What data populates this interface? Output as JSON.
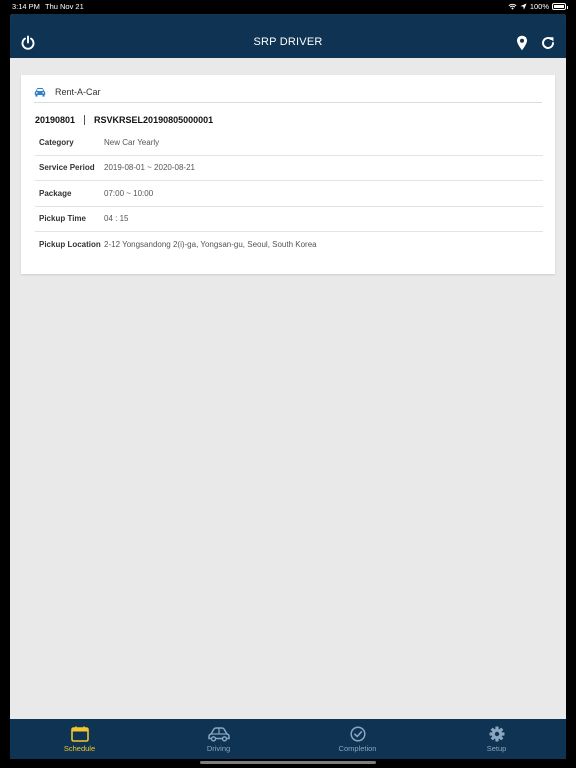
{
  "status_bar": {
    "time": "3:14 PM",
    "date": "Thu Nov 21",
    "battery": "100%"
  },
  "header": {
    "title": "SRP DRIVER",
    "icons": [
      "power-icon",
      "location-pin-icon",
      "refresh-icon"
    ]
  },
  "card": {
    "type_label": "Rent-A-Car",
    "date_code": "20190801",
    "reservation_id": "RSVKRSEL20190805000001",
    "rows": [
      {
        "label": "Category",
        "value": "New Car Yearly"
      },
      {
        "label": "Service Period",
        "value": "2019-08-01 ~ 2020-08-21"
      },
      {
        "label": "Package",
        "value": "07:00 ~ 10:00"
      },
      {
        "label": "Pickup Time",
        "value": "04 : 15"
      },
      {
        "label": "Pickup Location",
        "value": "2-12 Yongsandong 2(i)-ga, Yongsan-gu, Seoul, South Korea"
      }
    ]
  },
  "tabs": [
    {
      "label": "Schedule",
      "icon": "calendar-icon",
      "active": true
    },
    {
      "label": "Driving",
      "icon": "car-icon",
      "active": false
    },
    {
      "label": "Completion",
      "icon": "check-circle-icon",
      "active": false
    },
    {
      "label": "Setup",
      "icon": "gear-icon",
      "active": false
    }
  ],
  "colors": {
    "header_bg": "#0e3353",
    "active_tab": "#f3c531",
    "inactive_tab": "#8aa7c2",
    "accent_icon": "#2f7fc9"
  }
}
